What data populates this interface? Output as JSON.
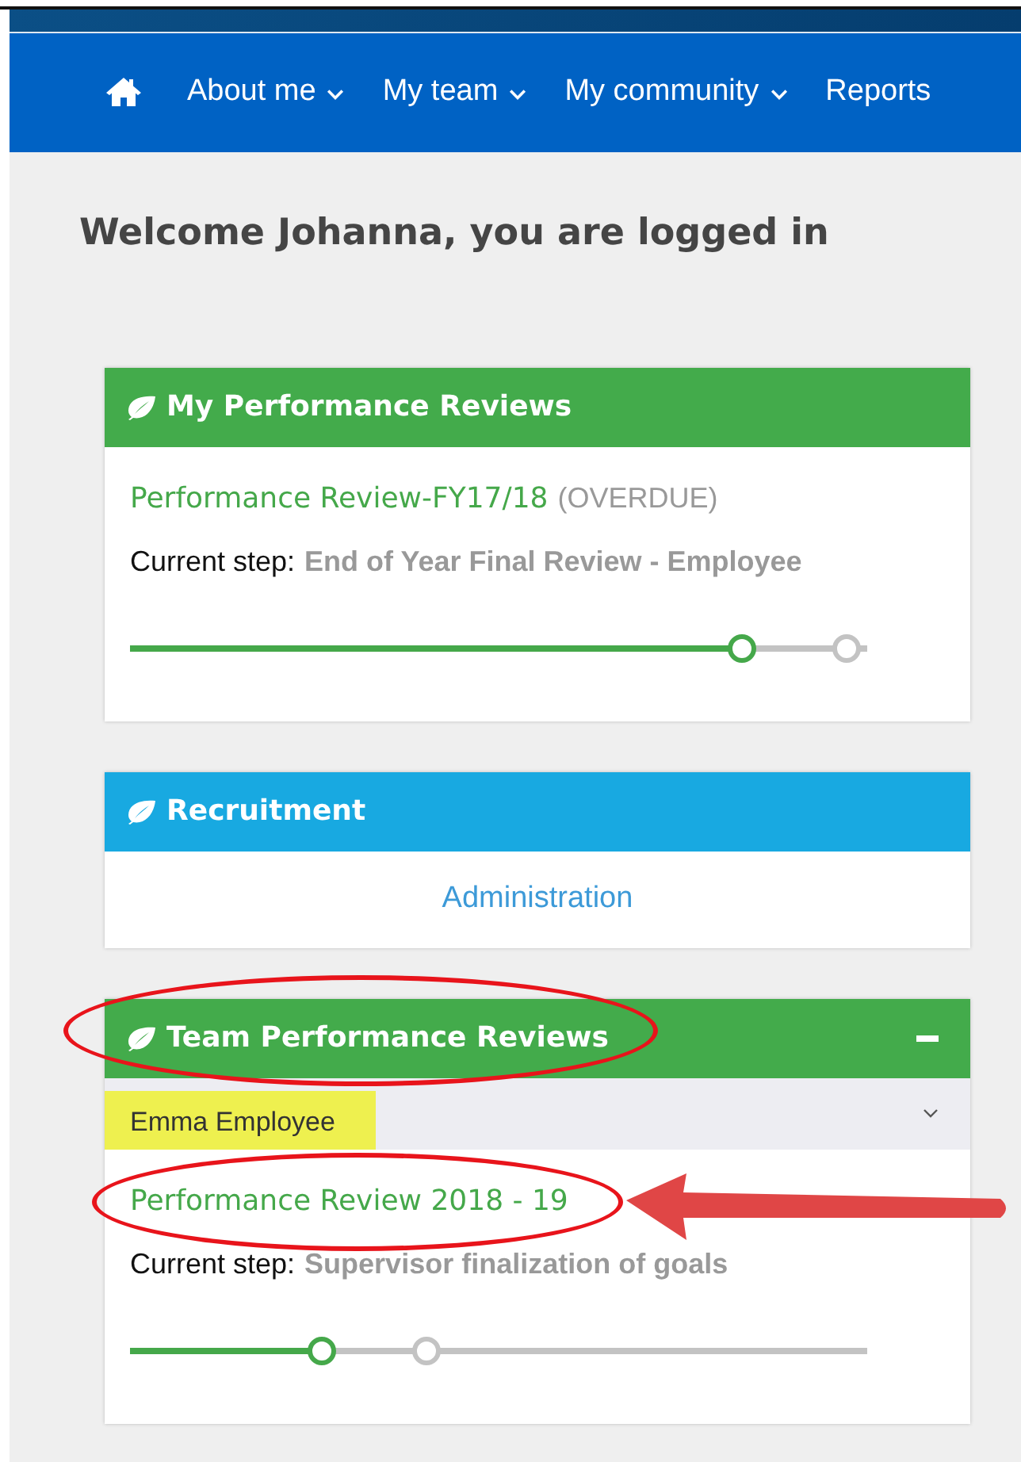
{
  "nav": {
    "items": [
      {
        "label": "About me",
        "dropdown": true
      },
      {
        "label": "My team",
        "dropdown": true
      },
      {
        "label": "My community",
        "dropdown": true
      },
      {
        "label": "Reports",
        "dropdown": false
      }
    ]
  },
  "welcome": "Welcome Johanna, you are logged in",
  "cards": [
    {
      "title": "My Performance Reviews",
      "color": "#43ab4b",
      "kind": "reviews",
      "reviews": [
        {
          "name": "Performance Review-FY17/18",
          "status": "(OVERDUE)",
          "step_label": "Current step:",
          "step": "End of Year Final Review - Employee",
          "level": 0.83
        }
      ]
    },
    {
      "title": "Recruitment",
      "color": "#18a9e1",
      "kind": "links",
      "links": [
        "Administration"
      ]
    },
    {
      "title": "Team Performance Reviews",
      "color": "#43ab4b",
      "kind": "reviews",
      "circled": true,
      "collapsible": true,
      "selector": {
        "value": "Emma Employee",
        "highlighted": true
      },
      "reviews": [
        {
          "name": "Performance Review 2018 - 19",
          "step_label": "Current step:",
          "step": "Supervisor finalization of goals",
          "level": 0.26,
          "circled": true,
          "arrow": true
        }
      ]
    }
  ]
}
